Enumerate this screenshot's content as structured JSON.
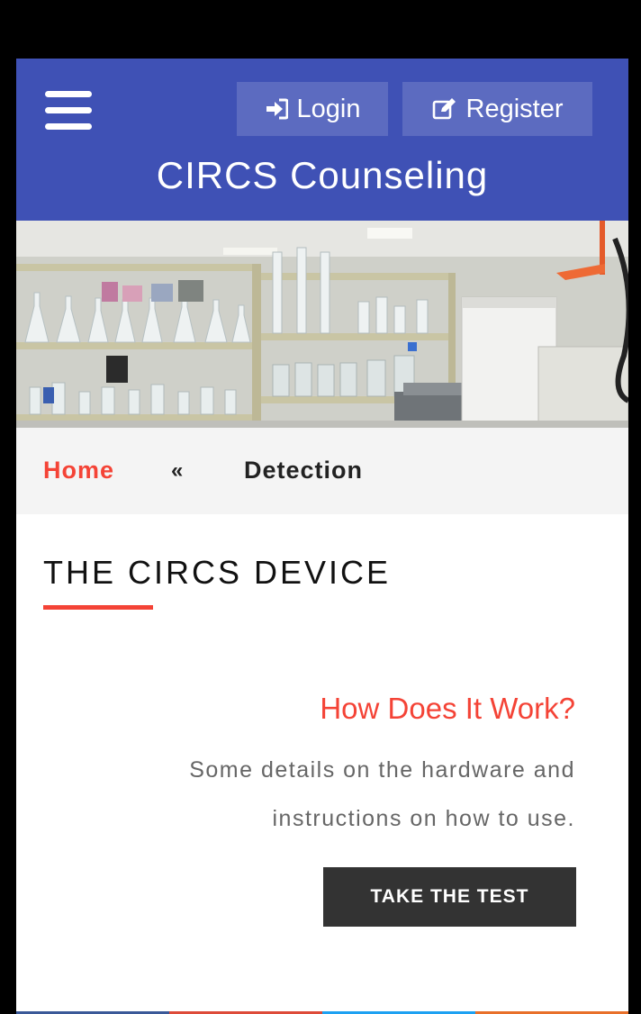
{
  "header": {
    "login_label": "Login",
    "register_label": "Register",
    "site_title": "CIRCS Counseling",
    "icons": {
      "menu": "hamburger-menu-icon",
      "login": "sign-in-icon",
      "register": "edit-icon"
    }
  },
  "breadcrumb": {
    "home": "Home",
    "separator": "«",
    "current": "Detection"
  },
  "section": {
    "title": "THE CIRCS DEVICE",
    "heading": "How Does It Work?",
    "description": "Some details on the hardware and instructions on how to use.",
    "cta_label": "TAKE THE TEST"
  },
  "colors": {
    "header_bg": "#3f51b5",
    "header_button_bg": "#5c6bc0",
    "accent": "#f44336",
    "cta_bg": "#333333",
    "breadcrumb_bg": "#f4f4f4",
    "footer_strip": [
      "#3b5998",
      "#dd4b39",
      "#1da1f2",
      "#e8702a"
    ]
  }
}
